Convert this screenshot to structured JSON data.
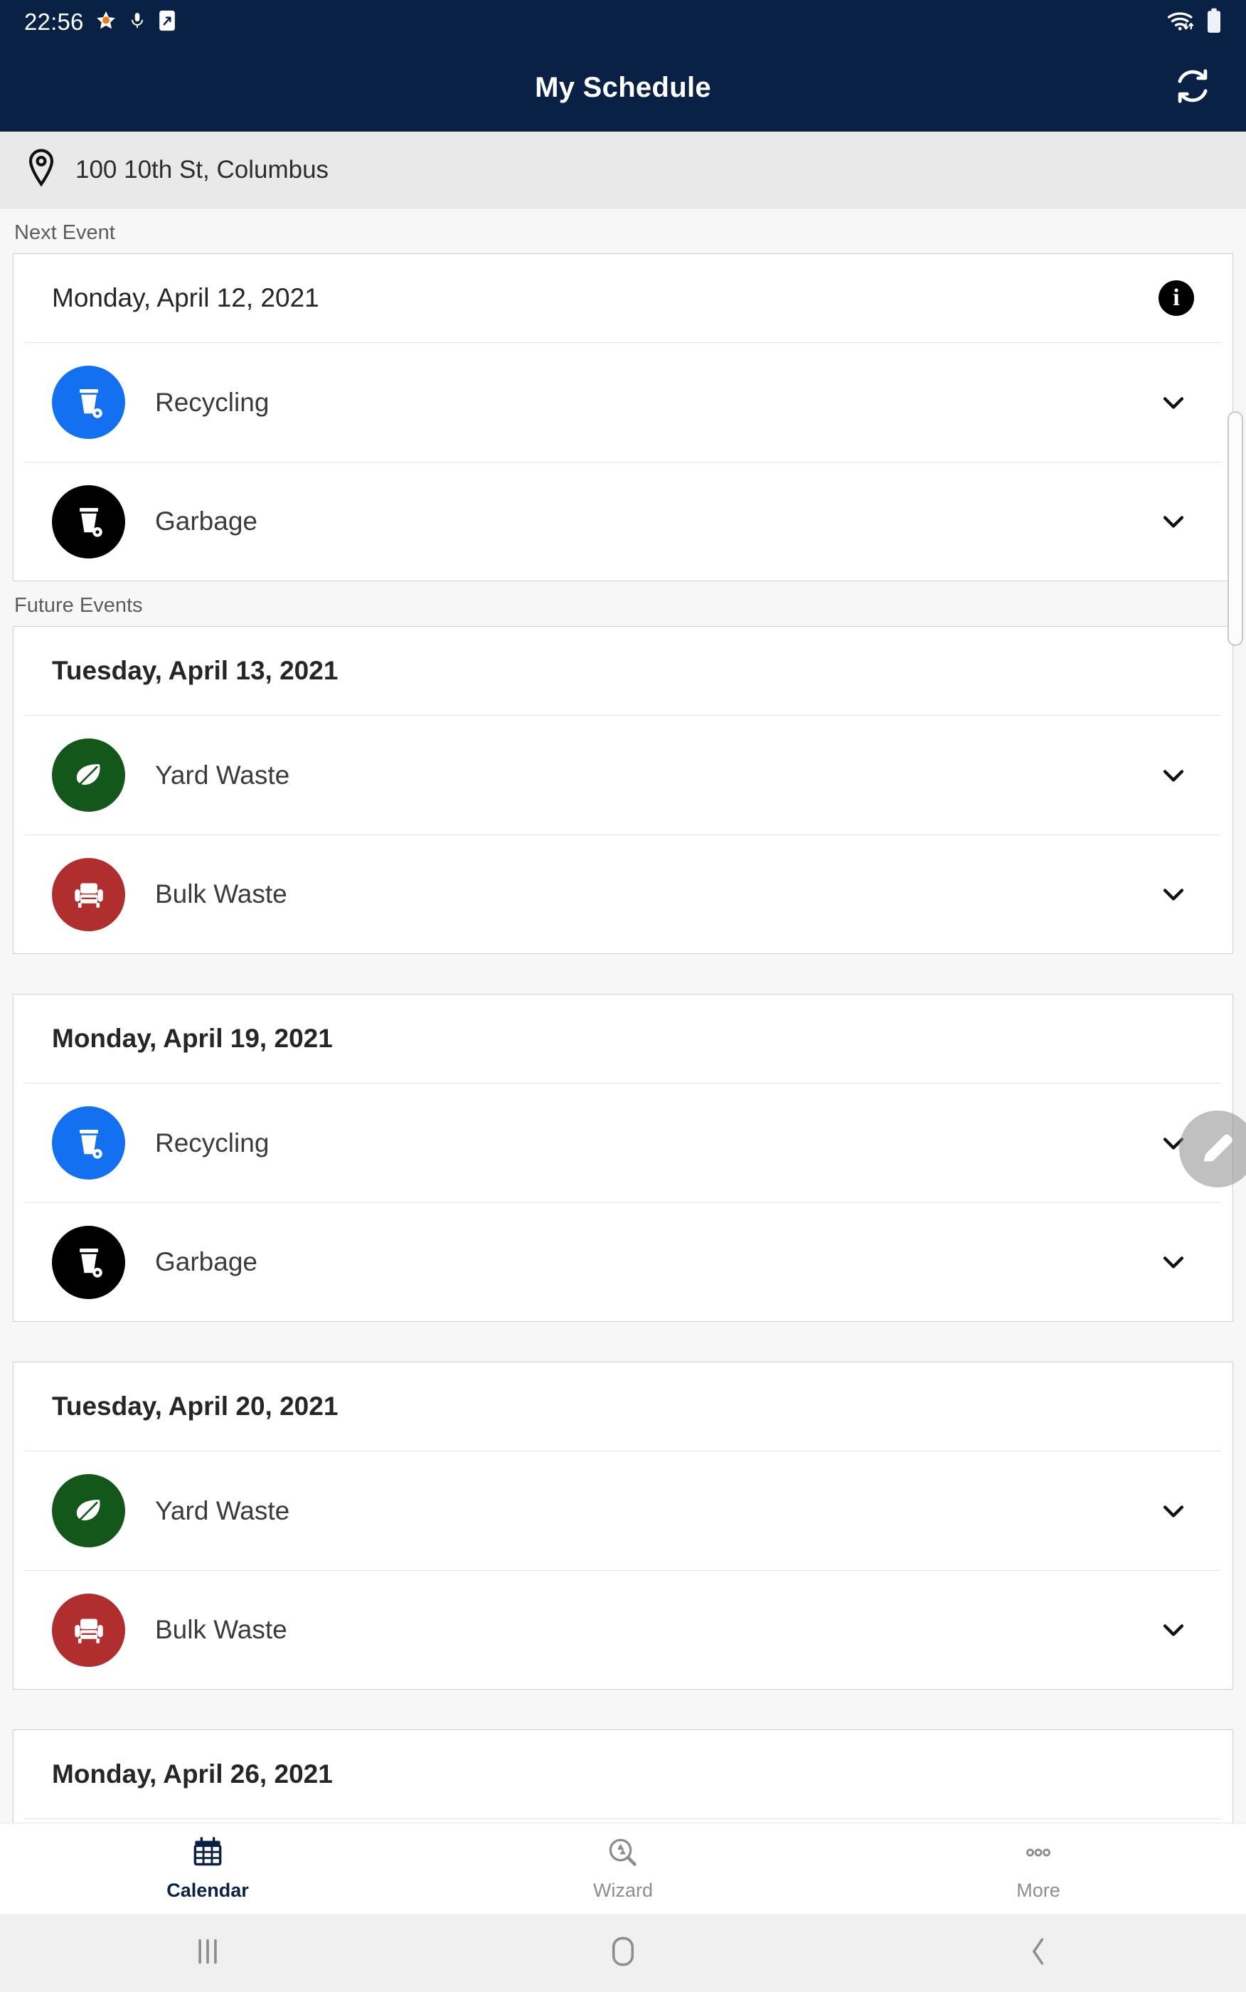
{
  "status_bar": {
    "time": "22:56",
    "left_icons": [
      "star-icon",
      "microphone-icon",
      "screenshot-icon"
    ],
    "right_icons": [
      "wifi-icon",
      "battery-icon"
    ]
  },
  "app_bar": {
    "title": "My Schedule",
    "action_icon": "refresh-icon",
    "background_color": "#0a2146"
  },
  "address_bar": {
    "icon": "location-pin-icon",
    "address": "100 10th St, Columbus",
    "background_color": "#e9e9e9"
  },
  "sections": [
    {
      "label": "Next Event",
      "cards": [
        {
          "date": "Monday, April 12, 2021",
          "bold": false,
          "has_info_icon": true,
          "info_icon": "info-icon",
          "events": [
            {
              "label": "Recycling",
              "icon": "wheeled-bin-icon",
              "color": "#1371f1",
              "chevron": "chevron-down-icon"
            },
            {
              "label": "Garbage",
              "icon": "wheeled-bin-icon",
              "color": "#000000",
              "chevron": "chevron-down-icon"
            }
          ]
        }
      ]
    },
    {
      "label": "Future Events",
      "cards": [
        {
          "date": "Tuesday, April 13, 2021",
          "bold": true,
          "has_info_icon": false,
          "events": [
            {
              "label": "Yard Waste",
              "icon": "leaf-icon",
              "color": "#14571a",
              "chevron": "chevron-down-icon"
            },
            {
              "label": "Bulk Waste",
              "icon": "armchair-icon",
              "color": "#b02e2e",
              "chevron": "chevron-down-icon"
            }
          ]
        },
        {
          "date": "Monday, April 19, 2021",
          "bold": true,
          "has_info_icon": false,
          "events": [
            {
              "label": "Recycling",
              "icon": "wheeled-bin-icon",
              "color": "#1371f1",
              "chevron": "chevron-down-icon"
            },
            {
              "label": "Garbage",
              "icon": "wheeled-bin-icon",
              "color": "#000000",
              "chevron": "chevron-down-icon"
            }
          ]
        },
        {
          "date": "Tuesday, April 20, 2021",
          "bold": true,
          "has_info_icon": false,
          "events": [
            {
              "label": "Yard Waste",
              "icon": "leaf-icon",
              "color": "#14571a",
              "chevron": "chevron-down-icon"
            },
            {
              "label": "Bulk Waste",
              "icon": "armchair-icon",
              "color": "#b02e2e",
              "chevron": "chevron-down-icon"
            }
          ]
        },
        {
          "date": "Monday, April 26, 2021",
          "bold": true,
          "has_info_icon": false,
          "partial": true,
          "events": []
        }
      ]
    }
  ],
  "fab": {
    "icon": "edit-pencil-icon"
  },
  "bottom_nav": {
    "items": [
      {
        "label": "Calendar",
        "icon": "calendar-icon",
        "active": true
      },
      {
        "label": "Wizard",
        "icon": "recycle-search-icon",
        "active": false
      },
      {
        "label": "More",
        "icon": "more-dots-icon",
        "active": false
      }
    ],
    "active_color": "#0a2146",
    "inactive_color": "#8d8d8d"
  },
  "android_nav": {
    "recents": "recents-icon",
    "home": "home-icon",
    "back": "back-icon"
  }
}
